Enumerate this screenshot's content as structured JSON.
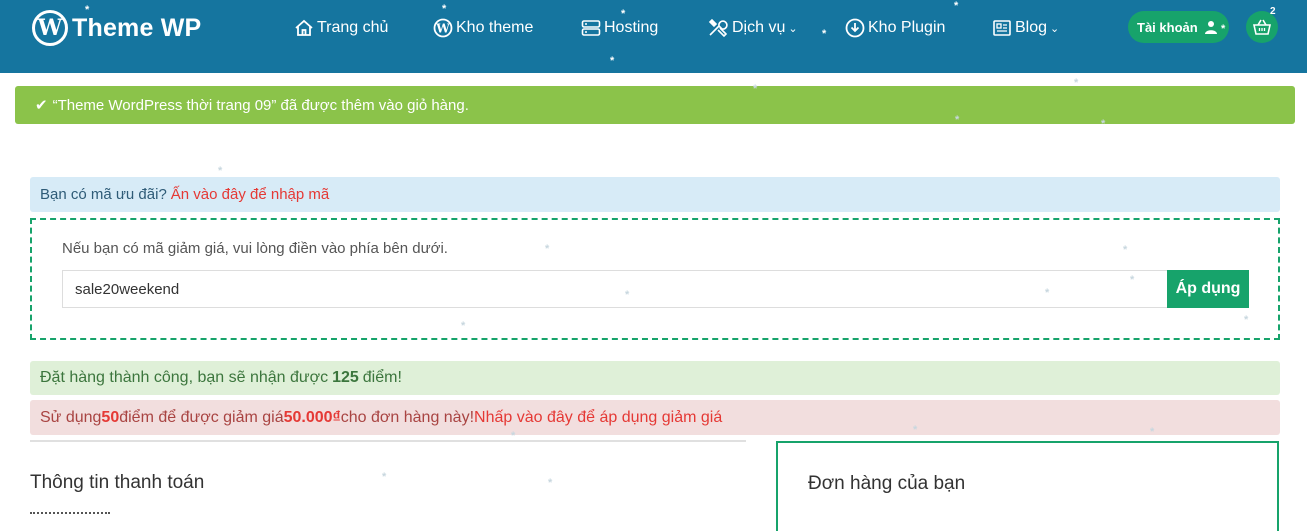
{
  "header": {
    "logo_mark": "W",
    "logo_text": "Theme WP",
    "nav": [
      {
        "label": "Trang chủ",
        "icon": "home-icon"
      },
      {
        "label": "Kho theme",
        "icon": "wordpress-icon"
      },
      {
        "label": "Hosting",
        "icon": "server-icon"
      },
      {
        "label": "Dịch vụ",
        "icon": "tools-icon",
        "dropdown": true
      },
      {
        "label": "Kho Plugin",
        "icon": "download-icon"
      },
      {
        "label": "Blog",
        "icon": "newspaper-icon",
        "dropdown": true
      }
    ],
    "account_label": "Tài khoản",
    "cart_count": "2"
  },
  "notices": {
    "added_to_cart": "“Theme WordPress thời trang 09” đã được thêm vào giỏ hàng.",
    "coupon_question": "Bạn có mã ưu đãi?",
    "coupon_link": "Ấn vào đây để nhập mã",
    "points_earned_prefix": "Đặt hàng thành công, bạn sẽ nhận được",
    "points_earned_value": "125",
    "points_earned_suffix": "điểm!",
    "points_use_prefix": "Sử dụng",
    "points_use_value": "50",
    "points_use_middle": "điểm để được giảm giá",
    "points_use_discount": "50.000₫",
    "points_use_suffix": "cho đơn hàng này!",
    "points_use_link": "Nhấp vào đây để áp dụng giảm giá"
  },
  "coupon_form": {
    "hint": "Nếu bạn có mã giảm giá, vui lòng điền vào phía bên dưới.",
    "value": "sale20weekend",
    "apply_label": "Áp dụng"
  },
  "checkout": {
    "billing_title": "Thông tin thanh toán",
    "order_title": "Đơn hàng của bạn"
  },
  "colors": {
    "header_bg": "#15759f",
    "accent_green": "#17a36b",
    "success_bar": "#8bc34a",
    "link_red": "#e53935"
  }
}
